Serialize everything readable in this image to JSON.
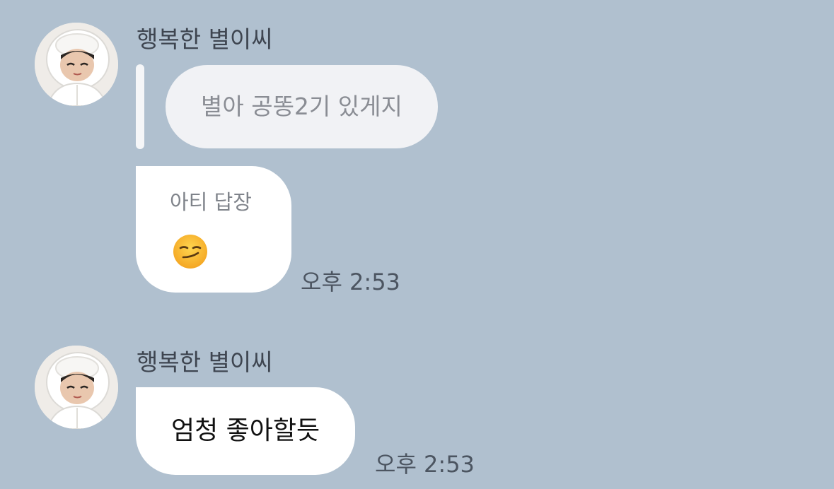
{
  "messages": [
    {
      "sender": "행복한 별이씨",
      "quoted_text": "별아 공똥2기 있게지",
      "reply_label": "아티 답장",
      "body_emoji": "smirking-face-emoji",
      "time": "오후 2:53"
    },
    {
      "sender": "행복한 별이씨",
      "text": "엄청 좋아할듯",
      "time": "오후 2:53"
    }
  ],
  "colors": {
    "background": "#b0c0cf",
    "bubble": "#ffffff",
    "quote_bubble": "#f1f2f5",
    "sender_text": "#3e4550",
    "time_text": "#4c5561"
  }
}
